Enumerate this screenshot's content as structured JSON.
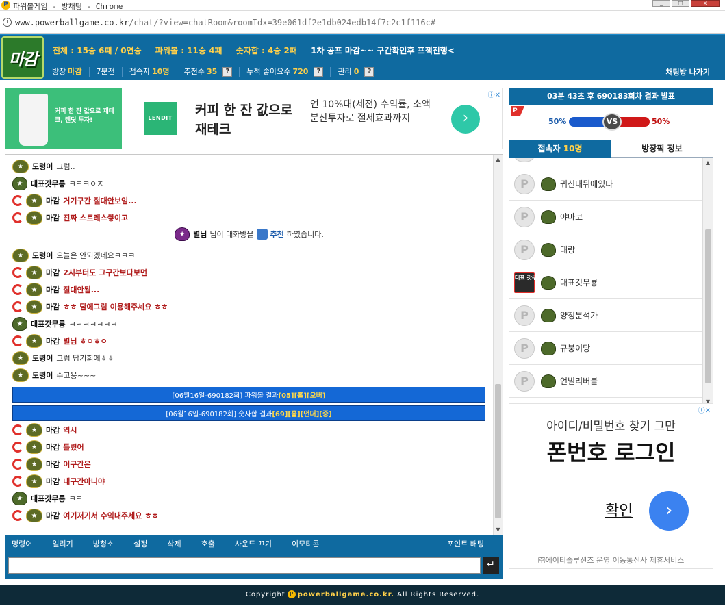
{
  "window": {
    "title": "파워볼게임 - 방채팅 - Chrome",
    "url_host": "www.powerballgame.co.kr",
    "url_path": "/chat/?view=chatRoom&roomIdx=39e061df2e1db024edb14f7c2c1f116c#"
  },
  "header": {
    "logo_text": "마감",
    "total": "전체 : 15승 6패 / 0연승",
    "powerball": "파워볼 : 11승 4패",
    "number_sum": "숫자합 : 4승 2패",
    "notice": "1차 공프 마감~~ 구간확인후 프잭진행<",
    "room_owner_label": "방장",
    "room_owner": "마감",
    "elapsed": "7분전",
    "visitors_label": "접속자",
    "visitors": "10명",
    "recommend_label": "추천수",
    "recommend": "35",
    "total_likes_label": "누적 좋아요수",
    "total_likes": "720",
    "manage_label": "관리",
    "manage": "0",
    "help_icon": "?",
    "exit": "채팅방 나가기"
  },
  "ad_top": {
    "cup_text": "커피 한 잔 값으로 재테크, 렌딧 투자!",
    "brand": "LENDIT",
    "headline": "커피 한 잔 값으로 재테크",
    "sub": "연 10%대(세전) 수익률, 소액 분산투자로 절세효과까지",
    "go": "›"
  },
  "messages": [
    {
      "nick": "도령이",
      "text": "그럼..",
      "style": "normal",
      "badge": "gold",
      "swirl": false
    },
    {
      "nick": "대표갓무룡",
      "text": "ㅋㅋㅋㅇㅈ",
      "style": "normal",
      "badge": "green",
      "swirl": false
    },
    {
      "nick": "마감",
      "text": "거기구간 절대안보임...",
      "style": "red",
      "badge": "gold",
      "swirl": true
    },
    {
      "nick": "마감",
      "text": "진짜 스트레스쌓이고",
      "style": "red",
      "badge": "gold",
      "swirl": true
    },
    {
      "nick": "도령이",
      "text": "오늘은 안되겠네요ㅋㅋㅋ",
      "style": "normal",
      "badge": "gold",
      "swirl": false
    },
    {
      "nick": "마감",
      "text": "2시부터도 그구간보다보면",
      "style": "red",
      "badge": "gold",
      "swirl": true
    },
    {
      "nick": "마감",
      "text": "절대안됨...",
      "style": "red",
      "badge": "gold",
      "swirl": true
    },
    {
      "nick": "마감",
      "text": "ㅎㅎ 담에그럼 이용해주세요 ㅎㅎ",
      "style": "red",
      "badge": "gold",
      "swirl": true
    },
    {
      "nick": "대표갓무룡",
      "text": "ㅋㅋㅋㅋㅋㅋㅋ",
      "style": "normal",
      "badge": "green",
      "swirl": false
    },
    {
      "nick": "마감",
      "text": "별님 ㅎㅇㅎㅇ",
      "style": "red",
      "badge": "gold",
      "swirl": true
    },
    {
      "nick": "도령이",
      "text": "그럼 담기회에ㅎㅎ",
      "style": "normal",
      "badge": "gold",
      "swirl": false
    },
    {
      "nick": "도령이",
      "text": "수고용~~~",
      "style": "normal",
      "badge": "gold",
      "swirl": false
    },
    {
      "nick": "마감",
      "text": "역시",
      "style": "red",
      "badge": "gold",
      "swirl": true
    },
    {
      "nick": "마감",
      "text": "틀렸어",
      "style": "red",
      "badge": "gold",
      "swirl": true
    },
    {
      "nick": "마감",
      "text": "이구간은",
      "style": "red",
      "badge": "gold",
      "swirl": true
    },
    {
      "nick": "마감",
      "text": "내구간아니야",
      "style": "red",
      "badge": "gold",
      "swirl": true
    },
    {
      "nick": "대표갓무룡",
      "text": "ㅋㅋ",
      "style": "normal",
      "badge": "green",
      "swirl": false
    },
    {
      "nick": "마감",
      "text": "여기저기서 수익내주세요 ㅎㅎ",
      "style": "red",
      "badge": "gold",
      "swirl": true
    }
  ],
  "system_msg": {
    "nick": "별님",
    "pre": "님이 대화방을",
    "action": "추천",
    "post": "하였습니다."
  },
  "results": [
    {
      "prefix": "[06월16일-690182회] 파워볼 결과 ",
      "value": "[05][홀][오버]"
    },
    {
      "prefix": "[06월16일-690182회] 숫자합 결과 ",
      "value": "[69][홀][언더][중]"
    }
  ],
  "toolbar": {
    "items": [
      "명령어",
      "얼리기",
      "방청소",
      "설정",
      "삭제",
      "호출",
      "사운드 끄기",
      "이모티콘"
    ],
    "bet": "포인트 배팅",
    "send": "↵"
  },
  "timer": {
    "header": "03분 43초 후 690183회차 결과 발표",
    "p_mark": "P",
    "left_pct": "50%",
    "right_pct": "50%",
    "vs": "VS"
  },
  "users_panel": {
    "tab_users": "접속자",
    "tab_users_count": "10명",
    "tab_info": "방장픽 정보",
    "users": [
      "귀신내뒤에있다",
      "야마코",
      "태랑",
      "대표갓무룡",
      "양정분석가",
      "규붕이당",
      "언빌리버블"
    ]
  },
  "ad_side": {
    "line1": "아이디/비밀번호 찾기 그만",
    "line2": "폰번호 로그인",
    "confirm": "확인",
    "footer": "㈜에이티솔루션즈 운영 이동통신사 제휴서비스"
  },
  "footer": {
    "pre": "Copyright",
    "brand": "powerballgame.co.kr.",
    "post": "All Rights Reserved."
  }
}
